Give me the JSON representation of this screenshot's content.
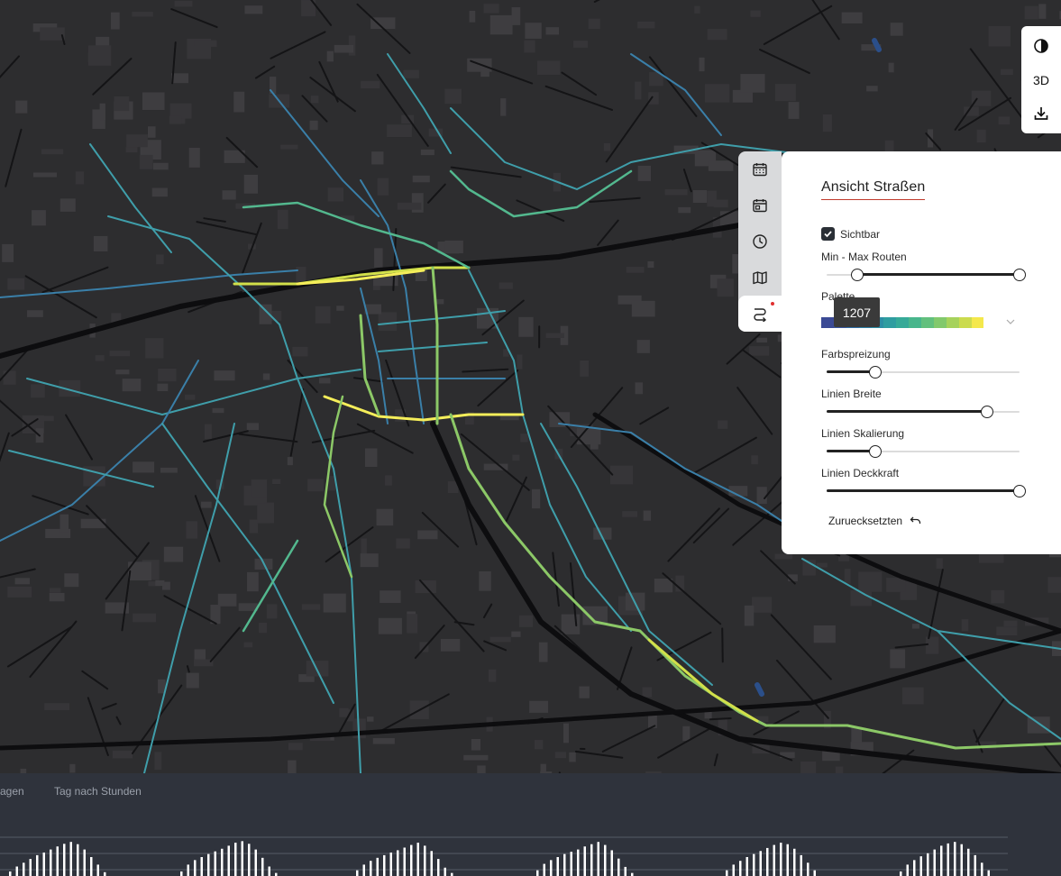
{
  "map": {
    "background": "#2d2d2f",
    "road_colors": [
      "#3a7fa8",
      "#3f9eaa",
      "#53b88e",
      "#8cc867",
      "#d2e04a",
      "#f5ee5a"
    ]
  },
  "map_controls": {
    "contrast_icon": "contrast-icon",
    "threed_label": "3D",
    "download_icon": "download-icon"
  },
  "tabs": [
    {
      "icon": "calendar-icon",
      "active": false
    },
    {
      "icon": "calendar-day-icon",
      "active": false
    },
    {
      "icon": "clock-icon",
      "active": false
    },
    {
      "icon": "map-icon",
      "active": false
    },
    {
      "icon": "route-icon",
      "active": true,
      "notification": true
    }
  ],
  "panel": {
    "title": "Ansicht Straßen",
    "visible_label": "Sichtbar",
    "visible_checked": true,
    "minmax_label": "Min - Max Routen",
    "minmax_value": [
      0.16,
      1.0
    ],
    "tooltip": "1207",
    "palette_label": "Palette",
    "palette_colors": [
      "#3b4a95",
      "#3a57a0",
      "#2e6ea6",
      "#2c7fa5",
      "#2c8ea4",
      "#2f9da0",
      "#36aa98",
      "#48b68c",
      "#62c07d",
      "#82c96c",
      "#a6d25c",
      "#cbdb4e",
      "#f4e84c",
      "#ffffff",
      "#ffffff",
      "#ffffff"
    ],
    "spread_label": "Farbspreizung",
    "spread_value": 0.25,
    "width_label": "Linien Breite",
    "width_value": 0.83,
    "scale_label": "Linien Skalierung",
    "scale_value": 0.25,
    "opacity_label": "Linien Deckkraft",
    "opacity_value": 1.0,
    "reset_label": "Zuruecksetzten",
    "accent": "#c0392b"
  },
  "timeline": {
    "tab_left": "agen",
    "tab_right": "Tag nach Stunden",
    "bar_color": "#ffffff",
    "groups": [
      [
        0.12,
        0.25,
        0.35,
        0.45,
        0.55,
        0.62,
        0.7,
        0.78,
        0.85,
        0.9,
        0.84,
        0.7,
        0.5,
        0.3,
        0.1
      ],
      [
        0.12,
        0.3,
        0.42,
        0.5,
        0.58,
        0.65,
        0.72,
        0.8,
        0.88,
        0.92,
        0.85,
        0.7,
        0.48,
        0.25,
        0.08
      ],
      [
        0.15,
        0.3,
        0.4,
        0.48,
        0.55,
        0.62,
        0.68,
        0.75,
        0.82,
        0.88,
        0.8,
        0.66,
        0.45,
        0.22,
        0.08
      ],
      [
        0.15,
        0.32,
        0.42,
        0.5,
        0.58,
        0.64,
        0.7,
        0.78,
        0.84,
        0.9,
        0.82,
        0.68,
        0.46,
        0.24,
        0.08
      ],
      [
        0.15,
        0.3,
        0.4,
        0.5,
        0.58,
        0.66,
        0.74,
        0.82,
        0.88,
        0.84,
        0.72,
        0.55,
        0.35,
        0.15
      ],
      [
        0.12,
        0.3,
        0.42,
        0.52,
        0.6,
        0.7,
        0.8,
        0.86,
        0.9,
        0.84,
        0.72,
        0.55,
        0.35,
        0.15
      ]
    ]
  }
}
